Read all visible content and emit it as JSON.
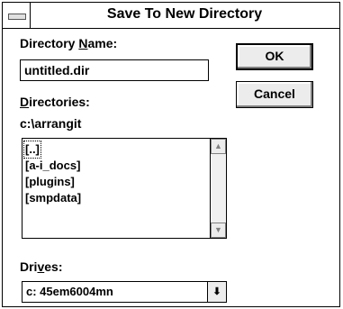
{
  "window": {
    "title": "Save To New Directory"
  },
  "directory_name": {
    "label_before": "Directory ",
    "label_mnemonic": "N",
    "label_after": "ame:",
    "value": "untitled.dir"
  },
  "directories": {
    "label_mnemonic": "D",
    "label_after": "irectories:",
    "current_path": "c:\\arrangit",
    "items": [
      "[..]",
      "[a-i_docs]",
      "[plugins]",
      "[smpdata]"
    ]
  },
  "drives": {
    "label_before": "Dri",
    "label_mnemonic": "v",
    "label_after": "es:",
    "selected": "c: 45em6004mn"
  },
  "buttons": {
    "ok": "OK",
    "cancel": "Cancel"
  },
  "icons": {
    "system_menu": "system-menu-icon",
    "scroll_up": "scroll-up-arrow-icon",
    "scroll_down": "scroll-down-arrow-icon",
    "dropdown": "dropdown-arrow-icon"
  }
}
